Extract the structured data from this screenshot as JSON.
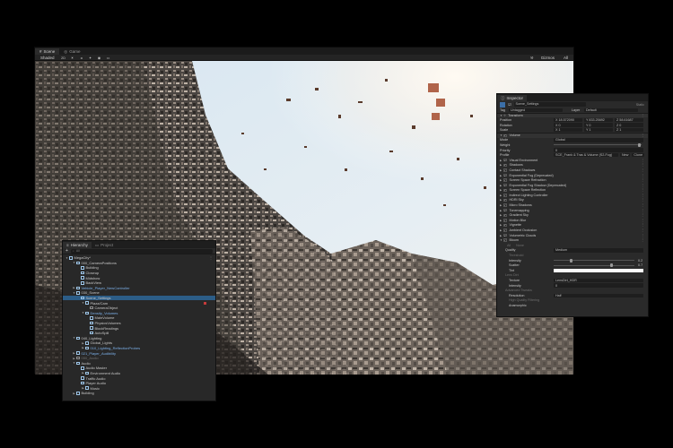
{
  "scene": {
    "tabs": [
      {
        "label": "Scene"
      },
      {
        "label": "Game"
      }
    ],
    "shading": "Shaded",
    "view_2d": "2D",
    "gizmos": "Gizmos",
    "search_placeholder": "All"
  },
  "hierarchy": {
    "tabs": [
      {
        "label": "Hierarchy"
      },
      {
        "label": "Project"
      }
    ],
    "add_label": "+",
    "search_placeholder": "All",
    "items": [
      {
        "label": "MegaCity*"
      },
      {
        "label": "000_CameraPositions"
      },
      {
        "label": "Building"
      },
      {
        "label": "Closeup"
      },
      {
        "label": "Midshow"
      },
      {
        "label": "BackView"
      },
      {
        "label": "Vehicle_Player_NewController"
      },
      {
        "label": "030_Scene"
      },
      {
        "label": "Scene_Settings"
      },
      {
        "label": "Plaza/Cam"
      },
      {
        "label": "CameraObject"
      },
      {
        "label": "Density_Volumes"
      },
      {
        "label": "MainVolume"
      },
      {
        "label": "PhysicsVolumes"
      },
      {
        "label": "BlockReadings"
      },
      {
        "label": "AutoSpill"
      },
      {
        "label": "040_Lighting"
      },
      {
        "label": "Global_Lights"
      },
      {
        "label": "010_Lighting_ReflectionProbes"
      },
      {
        "label": "021_Player_Audibility"
      },
      {
        "label": "050_Audio"
      },
      {
        "label": "Audio"
      },
      {
        "label": "Audio Master"
      },
      {
        "label": "Environment Audio"
      },
      {
        "label": "Traffic Audio"
      },
      {
        "label": "Player Audio"
      },
      {
        "label": "Music"
      },
      {
        "label": "Building"
      }
    ]
  },
  "inspector": {
    "title": "Inspector",
    "object_name": "Scene_Settings",
    "static_label": "Static",
    "tag_label": "Tag",
    "tag_value": "Untagged",
    "layer_label": "Layer",
    "layer_value": "Default",
    "transform": {
      "title": "Transform",
      "position_label": "Position",
      "rotation_label": "Rotation",
      "scale_label": "Scale",
      "pos": [
        "X 18.572090",
        "Y 833.25692",
        "Z 58.61687"
      ],
      "rot": [
        "X 0",
        "Y 0",
        "Z 0"
      ],
      "scale": [
        "X 1",
        "Y 1",
        "Z 1"
      ]
    },
    "volume": {
      "title": "Volume",
      "mode_label": "Mode",
      "mode_value": "Global",
      "weight_label": "Weight",
      "priority_label": "Priority",
      "priority_value": "0",
      "profile_label": "Profile",
      "profile_value": "SCE_Frank & Tras & Volume (S2-Fog)",
      "new_label": "New",
      "clone_label": "Clone"
    },
    "overrides": [
      {
        "label": "Visual Environment"
      },
      {
        "label": "Shadows"
      },
      {
        "label": "Contact Shadows"
      },
      {
        "label": "Exponential Fog (Deprecated)"
      },
      {
        "label": "Screen Space Refraction"
      },
      {
        "label": "Exponential Fog Shadow (Deprecated)"
      },
      {
        "label": "Screen Space Reflection"
      },
      {
        "label": "Indirect Lighting Controller"
      },
      {
        "label": "HDRI Sky"
      },
      {
        "label": "Micro Shadows"
      },
      {
        "label": "Tonemapping"
      },
      {
        "label": "Gradient Sky"
      },
      {
        "label": "Motion Blur"
      },
      {
        "label": "Vignette"
      },
      {
        "label": "Ambient Occlusion"
      },
      {
        "label": "Volumetric Clouds"
      },
      {
        "label": "Bloom"
      }
    ],
    "bloom": {
      "all_label": "All",
      "none_label": "None",
      "quality_label": "Quality",
      "quality_value": "Medium",
      "threshold_label": "Threshold",
      "intensity_label": "Intensity",
      "intensity_value": "0.2",
      "scatter_label": "Scatter",
      "scatter_value": "0.7",
      "tint_label": "Tint",
      "lens_dirt_label": "Lens Dirt",
      "texture_label": "Texture",
      "texture_value": "LensDirt_HDR",
      "lens_intensity_label": "Intensity",
      "lens_intensity_value": "0",
      "advanced_label": "Advanced Tweaks",
      "resolution_label": "Resolution",
      "resolution_value": "Half",
      "hq_label": "High Quality Filtering",
      "anamorphic_label": "Anamorphic"
    }
  }
}
